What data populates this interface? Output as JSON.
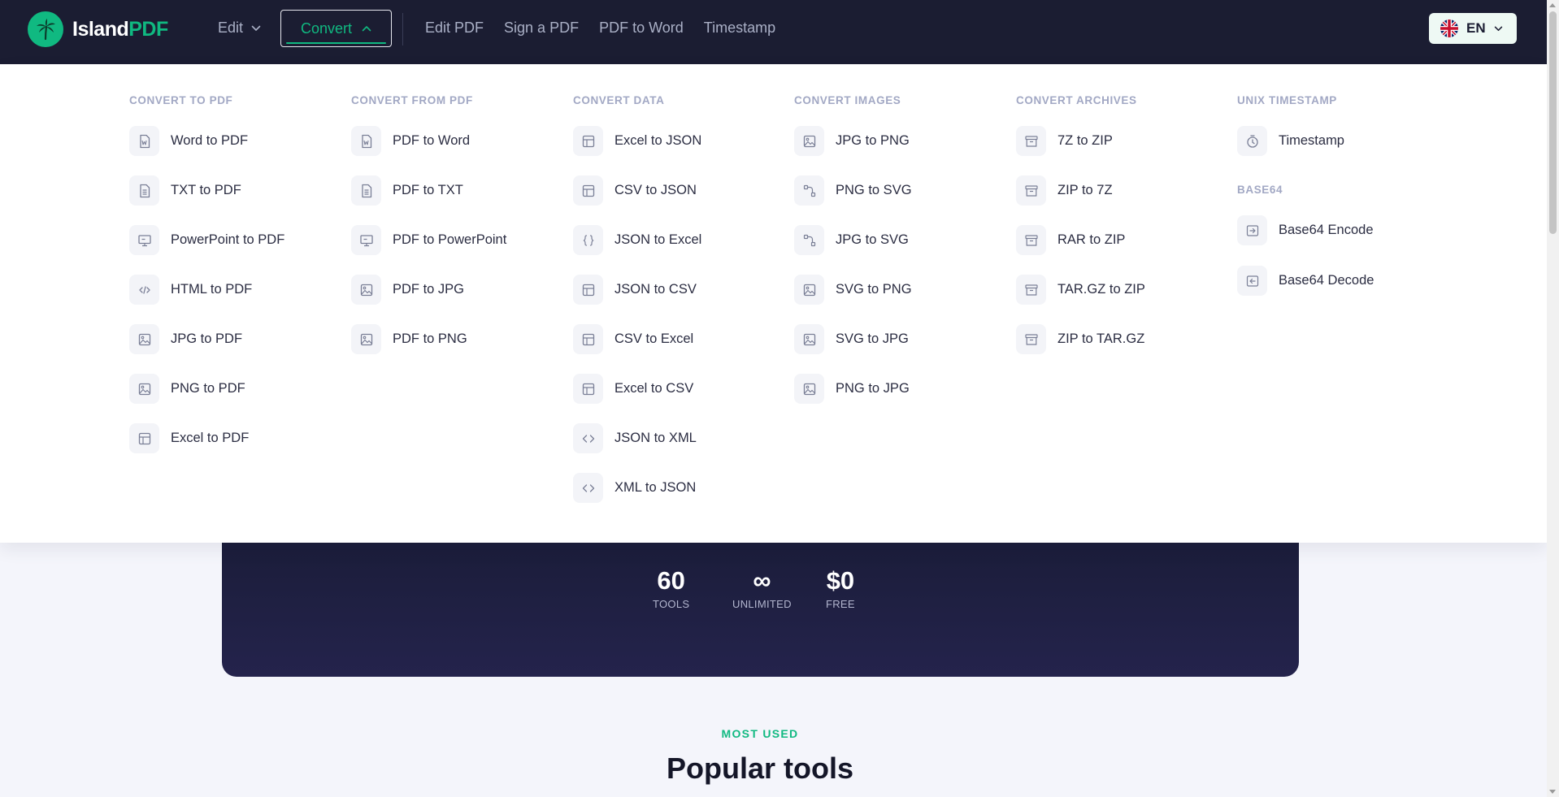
{
  "brand": {
    "name_white": "Island",
    "name_green": "PDF"
  },
  "nav": {
    "edit_label": "Edit",
    "convert_label": "Convert",
    "links": [
      "Edit PDF",
      "Sign a PDF",
      "PDF to Word",
      "Timestamp"
    ]
  },
  "lang": {
    "code": "EN"
  },
  "menu": {
    "convert_to_pdf": {
      "heading": "CONVERT TO PDF",
      "items": [
        "Word to PDF",
        "TXT to PDF",
        "PowerPoint to PDF",
        "HTML to PDF",
        "JPG to PDF",
        "PNG to PDF",
        "Excel to PDF"
      ]
    },
    "convert_from_pdf": {
      "heading": "CONVERT FROM PDF",
      "items": [
        "PDF to Word",
        "PDF to TXT",
        "PDF to PowerPoint",
        "PDF to JPG",
        "PDF to PNG"
      ]
    },
    "convert_data": {
      "heading": "CONVERT DATA",
      "items": [
        "Excel to JSON",
        "CSV to JSON",
        "JSON to Excel",
        "JSON to CSV",
        "CSV to Excel",
        "Excel to CSV",
        "JSON to XML",
        "XML to JSON"
      ]
    },
    "convert_images": {
      "heading": "CONVERT IMAGES",
      "items": [
        "JPG to PNG",
        "PNG to SVG",
        "JPG to SVG",
        "SVG to PNG",
        "SVG to JPG",
        "PNG to JPG"
      ]
    },
    "convert_archives": {
      "heading": "CONVERT ARCHIVES",
      "items": [
        "7Z to ZIP",
        "ZIP to 7Z",
        "RAR to ZIP",
        "TAR.GZ to ZIP",
        "ZIP to TAR.GZ"
      ]
    },
    "unix_timestamp": {
      "heading": "UNIX TIMESTAMP",
      "items": [
        "Timestamp"
      ]
    },
    "base64": {
      "heading": "BASE64",
      "items": [
        "Base64 Encode",
        "Base64 Decode"
      ]
    }
  },
  "stats": [
    {
      "value": "60",
      "label": "TOOLS"
    },
    {
      "value": "∞",
      "label": "UNLIMITED"
    },
    {
      "value": "$0",
      "label": "FREE"
    }
  ],
  "section": {
    "kicker": "MOST USED",
    "title": "Popular tools"
  },
  "colors": {
    "nav_bg": "#1b1d32",
    "accent": "#10b981",
    "hero_bg": "#1e1e40"
  }
}
